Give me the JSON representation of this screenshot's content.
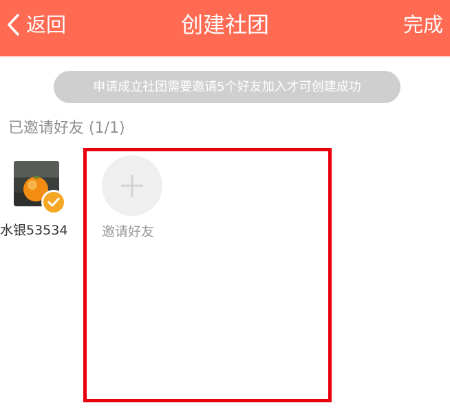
{
  "header": {
    "back_label": "返回",
    "title": "创建社团",
    "done_label": "完成",
    "background_color": "#FF6A52"
  },
  "notice": {
    "text": "申请成立社团需要邀请5个好友加入才可创建成功"
  },
  "invited_section": {
    "label": "已邀请好友 (1/1)"
  },
  "members": [
    {
      "name": "水银53534",
      "selected": true
    }
  ],
  "invite_button": {
    "label": "邀请好友",
    "icon": "plus-icon"
  },
  "icons": {
    "back": "chevron-left-icon",
    "check": "check-icon",
    "plus": "plus-icon"
  },
  "colors": {
    "header": "#FF6A52",
    "check_badge": "#F5A623",
    "highlight": "#E8000B"
  }
}
